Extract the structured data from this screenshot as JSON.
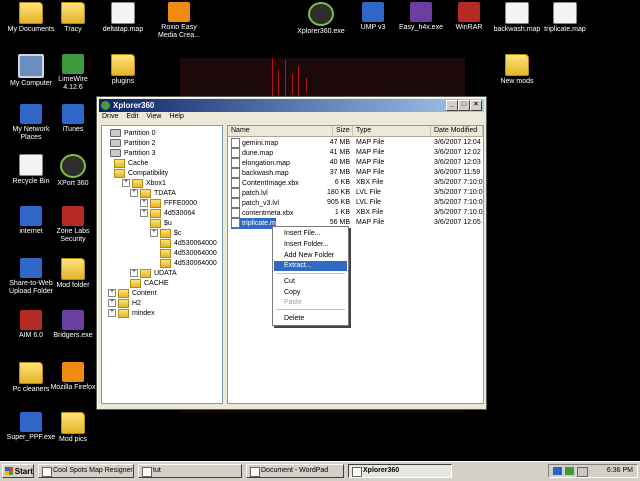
{
  "desktop": {
    "icons": [
      {
        "label": "My Documents",
        "icon": "folder-icon",
        "kind": "folder"
      },
      {
        "label": "Tracy",
        "icon": "folder-icon",
        "kind": "folder"
      },
      {
        "label": "deltatap.map",
        "icon": "file-icon",
        "kind": "doc"
      },
      {
        "label": "Roxio Easy",
        "sub": "Media Crea...",
        "icon": "roxio-icon",
        "kind": "orange"
      },
      {
        "label": "Xplorer360.exe",
        "icon": "xbox-icon",
        "kind": "xbox"
      },
      {
        "label": "UMP v3",
        "icon": "ump-icon",
        "kind": "blue"
      },
      {
        "label": "Easy_h4x.exe",
        "icon": "app-icon",
        "kind": "purple"
      },
      {
        "label": "WinRAR",
        "icon": "winrar-icon",
        "kind": "red"
      },
      {
        "label": "backwash.map",
        "icon": "file-icon",
        "kind": "doc"
      },
      {
        "label": "triplicate.map",
        "icon": "file-icon",
        "kind": "doc"
      },
      {
        "label": "My Computer",
        "icon": "computer-icon",
        "kind": "pc"
      },
      {
        "label": "LimeWire",
        "sub": "4.12.6",
        "icon": "limewire-icon",
        "kind": "green"
      },
      {
        "label": "plugins",
        "icon": "folder-icon",
        "kind": "folder"
      },
      {
        "label": "New mods",
        "icon": "folder-icon",
        "kind": "folder"
      },
      {
        "label": "My Network",
        "sub": "Places",
        "icon": "network-icon",
        "kind": "blue"
      },
      {
        "label": "iTunes",
        "icon": "itunes-icon",
        "kind": "blue"
      },
      {
        "label": "Recycle Bin",
        "icon": "recycle-bin-icon",
        "kind": "doc"
      },
      {
        "label": "XPort 360",
        "icon": "xbox-icon",
        "kind": "xbox"
      },
      {
        "label": "internet",
        "icon": "ie-icon",
        "kind": "blue"
      },
      {
        "label": "Zone Labs",
        "sub": "Security",
        "icon": "zonealarm-icon",
        "kind": "red"
      },
      {
        "label": "Share-to-Web",
        "sub": "Upload Folder",
        "icon": "hp-icon",
        "kind": "blue"
      },
      {
        "label": "Mod folder",
        "icon": "folder-icon",
        "kind": "folder"
      },
      {
        "label": "AIM 6.0",
        "icon": "aim-icon",
        "kind": "red"
      },
      {
        "label": "Bridgers.exe",
        "icon": "app-icon",
        "kind": "purple"
      },
      {
        "label": "Pc cleaners",
        "icon": "folder-icon",
        "kind": "folder"
      },
      {
        "label": "Mozilla Firefox",
        "icon": "firefox-icon",
        "kind": "orange"
      },
      {
        "label": "Super_PPF.exe",
        "icon": "app-icon",
        "kind": "blue"
      },
      {
        "label": "Mod pics",
        "icon": "folder-icon",
        "kind": "folder"
      }
    ]
  },
  "window": {
    "title": "Xplorer360",
    "menu": [
      "Drive",
      "Edit",
      "View",
      "Help"
    ],
    "tree": [
      {
        "label": "Partition 0",
        "type": "drive"
      },
      {
        "label": "Partition 2",
        "type": "drive"
      },
      {
        "label": "Partition 3",
        "type": "drive"
      },
      {
        "label": "Cache",
        "type": "folder"
      },
      {
        "label": "Compatibility",
        "type": "folder"
      },
      {
        "label": "Xbox1",
        "type": "folder"
      },
      {
        "label": "TDATA",
        "type": "folder"
      },
      {
        "label": "FFFE0000",
        "type": "folder"
      },
      {
        "label": "4d530064",
        "type": "folder"
      },
      {
        "label": "$u",
        "type": "folder"
      },
      {
        "label": "$c",
        "type": "folder"
      },
      {
        "label": "4d530064000",
        "type": "folder"
      },
      {
        "label": "4d530064000",
        "type": "folder"
      },
      {
        "label": "4d530064000",
        "type": "folder"
      },
      {
        "label": "UDATA",
        "type": "folder"
      },
      {
        "label": "CACHE",
        "type": "folder"
      },
      {
        "label": "Content",
        "type": "folder"
      },
      {
        "label": "H2",
        "type": "folder"
      },
      {
        "label": "mindex",
        "type": "folder"
      }
    ],
    "columns": [
      "Name",
      "Size",
      "Type",
      "Date Modified"
    ],
    "files": [
      {
        "name": "gemini.map",
        "size": "47 MB",
        "type": "MAP File",
        "date": "3/6/2007 12:04"
      },
      {
        "name": "dune.map",
        "size": "41 MB",
        "type": "MAP File",
        "date": "3/6/2007 12:02"
      },
      {
        "name": "elongation.map",
        "size": "40 MB",
        "type": "MAP File",
        "date": "3/6/2007 12:03"
      },
      {
        "name": "backwash.map",
        "size": "37 MB",
        "type": "MAP File",
        "date": "3/6/2007 11:59"
      },
      {
        "name": "ContentImage.xbx",
        "size": "6 KB",
        "type": "XBX File",
        "date": "3/5/2007 7:10:0"
      },
      {
        "name": "patch.lvl",
        "size": "180 KB",
        "type": "LVL File",
        "date": "3/5/2007 7:10:0"
      },
      {
        "name": "patch_v3.lvl",
        "size": "905 KB",
        "type": "LVL File",
        "date": "3/5/2007 7:10:0"
      },
      {
        "name": "contentmeta.xbx",
        "size": "1 KB",
        "type": "XBX File",
        "date": "3/5/2007 7:10:0"
      },
      {
        "name": "triplicate.m",
        "size": "56 MB",
        "type": "MAP File",
        "date": "3/6/2007 12:05"
      }
    ],
    "context_menu": [
      {
        "label": "Insert File...",
        "state": "normal"
      },
      {
        "label": "Insert Folder...",
        "state": "normal"
      },
      {
        "label": "Add New Folder",
        "state": "normal"
      },
      {
        "label": "Extract...",
        "state": "highlighted"
      },
      {
        "label": "Cut",
        "state": "normal"
      },
      {
        "label": "Copy",
        "state": "normal"
      },
      {
        "label": "Paste",
        "state": "disabled"
      },
      {
        "label": "Delete",
        "state": "normal"
      }
    ]
  },
  "taskbar": {
    "start_label": "Start",
    "buttons": [
      {
        "label": "Cool Spots Map Resigner...",
        "active": false
      },
      {
        "label": "tut",
        "active": false
      },
      {
        "label": "Document - WordPad",
        "active": false
      },
      {
        "label": "Xplorer360",
        "active": true
      }
    ],
    "clock": "6:36 PM"
  }
}
